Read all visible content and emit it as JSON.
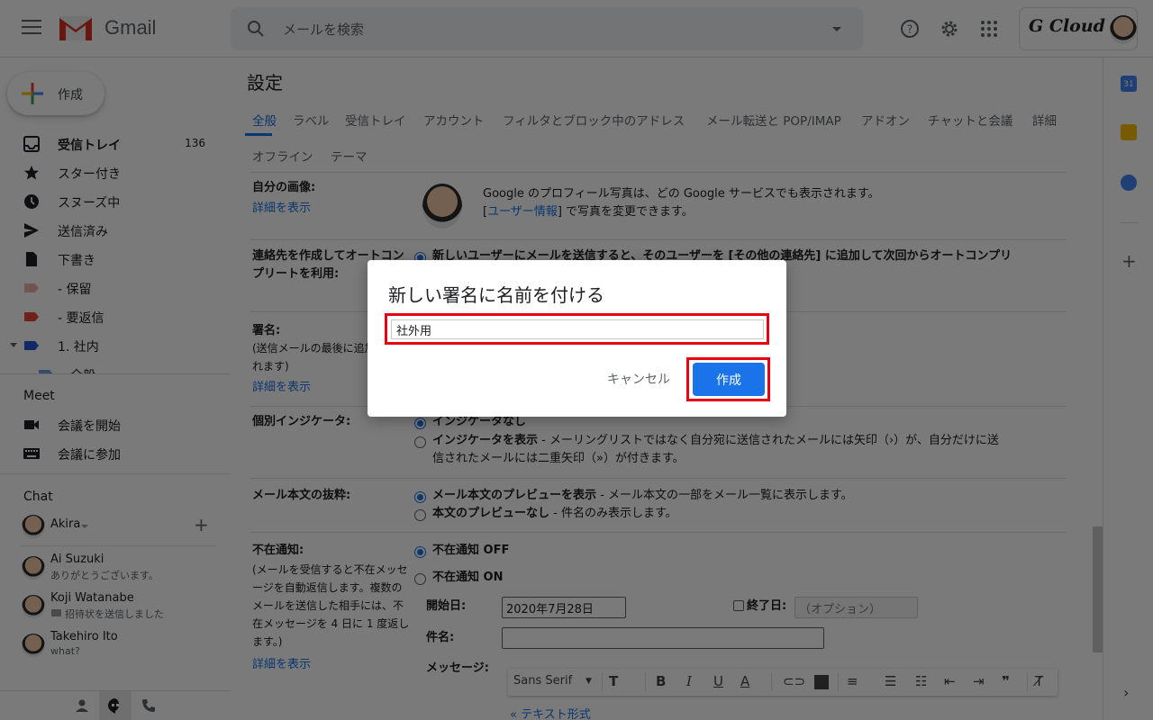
{
  "header": {
    "app_name": "Gmail",
    "search_placeholder": "メールを検索",
    "account_brand": "G Cloud",
    "icons": [
      "menu-icon",
      "help-icon",
      "settings-icon",
      "apps-icon"
    ]
  },
  "nav": {
    "compose_label": "作成",
    "items": [
      {
        "label": "受信トレイ",
        "count": "136",
        "icon": "inbox-icon",
        "bold": true
      },
      {
        "label": "スター付き",
        "icon": "star-icon"
      },
      {
        "label": "スヌーズ中",
        "icon": "clock-icon"
      },
      {
        "label": "送信済み",
        "icon": "send-icon"
      },
      {
        "label": "下書き",
        "icon": "draft-icon"
      },
      {
        "label": "- 保留",
        "icon": "label-icon",
        "color": "#c9948e"
      },
      {
        "label": "- 要返信",
        "icon": "label-icon",
        "color": "#c5403a"
      },
      {
        "label": "1. 社内",
        "icon": "label-icon",
        "color": "#1f4fb5"
      },
      {
        "label": "全般",
        "icon": "label-icon",
        "color": "#4a86e8"
      }
    ],
    "meet": {
      "title": "Meet",
      "items": [
        {
          "label": "会議を開始",
          "icon": "video-icon"
        },
        {
          "label": "会議に参加",
          "icon": "keyboard-icon"
        }
      ]
    },
    "chat": {
      "title": "Chat",
      "me": "Akira",
      "people": [
        {
          "name": "Ai Suzuki",
          "message": "ありがとうございます。"
        },
        {
          "name": "Koji Watanabe",
          "message": "招待状を送信しました"
        },
        {
          "name": "Takehiro Ito",
          "message": "what?"
        }
      ]
    }
  },
  "main": {
    "title": "設定",
    "tabs": [
      "全般",
      "ラベル",
      "受信トレイ",
      "アカウント",
      "フィルタとブロック中のアドレス",
      "メール転送と POP/IMAP",
      "アドオン",
      "チャットと会議",
      "詳細",
      "オフライン",
      "テーマ"
    ],
    "active_tab": "全般",
    "my_picture": {
      "label": "自分の画像:",
      "link": "詳細を表示",
      "line1": "Google のプロフィール写真は、どの Google サービスでも表示されます。",
      "line2_link": "ユーザー情報",
      "line2": " で写真を変更できます。"
    },
    "autocomplete": {
      "label": "連絡先を作成してオートコンプリートを利用:",
      "option1": "新しいユーザーにメールを送信すると、そのユーザーを [その他の連絡先] に追加して次回からオートコンプリ"
    },
    "signature": {
      "label": "署名:",
      "sub": "(送信メールの最後に追加されます)",
      "link": "詳細を表示"
    },
    "indicators": {
      "label": "個別インジケータ:",
      "option1": "インジケータなし",
      "option2_bold": "インジケータを表示",
      "option2_rest": " - メーリングリストではなく自分宛に送信されたメールには矢印（›）が、自分だけに送",
      "option2_rest2": "信されたメールには二重矢印（»）が付きます。",
      "selected": 1
    },
    "snippets": {
      "label": "メール本文の抜粋:",
      "option1_bold": "メール本文のプレビューを表示",
      "option1_rest": " - メール本文の一部をメール一覧に表示します。",
      "option2_bold": "本文のプレビューなし",
      "option2_rest": " - 件名のみ表示します。",
      "selected": 1
    },
    "vacation": {
      "label": "不在通知:",
      "desc": "(メールを受信すると不在メッセージを自動返信します。複数のメールを送信した相手には、不在メッセージを 4 日に 1 度返します。)",
      "link": "詳細を表示",
      "off": "不在通知 OFF",
      "on": "不在通知 ON",
      "selected": "OFF",
      "start_label": "開始日:",
      "start_value": "2020年7月28日",
      "end_label": "終了日:",
      "end_placeholder": "（オプション）",
      "subject_label": "件名:",
      "subject_value": "",
      "message_label": "メッセージ:",
      "font": "Sans Serif",
      "plain_text_link": "« テキスト形式"
    }
  },
  "dialog": {
    "title": "新しい署名に名前を付ける",
    "input_value": "社外用",
    "cancel_label": "キャンセル",
    "create_label": "作成",
    "highlight_color": "#e60012",
    "accent": "#1a73e8"
  }
}
